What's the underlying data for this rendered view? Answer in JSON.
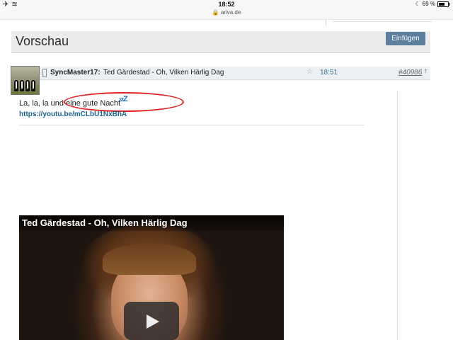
{
  "status_bar": {
    "time": "18:52",
    "url": "ariva.de",
    "battery": "69 %",
    "icons": [
      "airplane-icon",
      "wifi-icon",
      "moon-icon",
      "battery-icon"
    ]
  },
  "header": {
    "title": "Vorschau",
    "insert_button": "Einfügen",
    "button_color": "#5c7f9e"
  },
  "post": {
    "author": "SyncMaster17:",
    "title": "Ted Gärdestad - Oh, Vilken Härlig Dag",
    "time": "18:51",
    "number": "#40986",
    "text": "La, la, la und eine gute Nacht",
    "emoji": "zzZ",
    "link": "https://youtu.be/mCLbU1NxBhA"
  },
  "video": {
    "title": "Ted Gärdestad - Oh, Vilken Härlig Dag"
  },
  "annotation_color": "#e02222"
}
